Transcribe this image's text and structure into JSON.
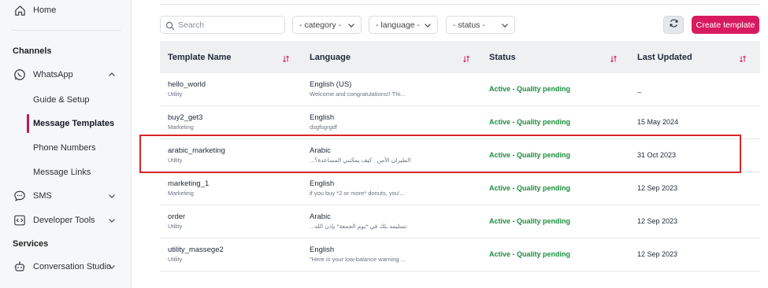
{
  "sidebar": {
    "home": "Home",
    "channels_title": "Channels",
    "whatsapp": "WhatsApp",
    "guide_setup": "Guide & Setup",
    "message_templates": "Message Templates",
    "phone_numbers": "Phone Numbers",
    "message_links": "Message Links",
    "sms": "SMS",
    "developer_tools": "Developer Tools",
    "services_title": "Services",
    "conversation_studio": "Conversation Studio"
  },
  "toolbar": {
    "search_placeholder": "Search",
    "category_label": "- category -",
    "language_label": "- language -",
    "status_label": "- status -",
    "create_label": "Create template"
  },
  "table": {
    "columns": [
      "Template Name",
      "Language",
      "Status",
      "Last Updated"
    ],
    "rows": [
      {
        "name": "hello_world",
        "category": "Utility",
        "language": "English (US)",
        "preview": "Welcome and congratulations!! Thi...",
        "status": "Active - Quality pending",
        "updated": "_"
      },
      {
        "name": "buy2_get3",
        "category": "Marketing",
        "language": "English",
        "preview": "dsgfsgrgdf",
        "status": "Active - Quality pending",
        "updated": "15 May 2024"
      },
      {
        "name": "arabic_marketing",
        "category": "Utility",
        "language": "Arabic",
        "preview": "...ة الطيران الأمن . كيف يمكنني المساعدة؟",
        "status": "Active - Quality pending",
        "updated": "31 Oct 2023"
      },
      {
        "name": "marketing_1",
        "category": "Marketing",
        "language": "English",
        "preview": "if you buy *2 or more* donuts, you'...",
        "status": "Active - Quality pending",
        "updated": "12 Sep 2023"
      },
      {
        "name": "order",
        "category": "Utility",
        "language": "Arabic",
        "preview": "...تسليمه ـلك في *يوم الجمعة* بإذن الله",
        "status": "Active - Quality pending",
        "updated": "12 Sep 2023"
      },
      {
        "name": "utility_massege2",
        "category": "Utility",
        "language": "English",
        "preview": "\"Here is your low-balance warning ...",
        "status": "Active - Quality pending",
        "updated": "12 Sep 2023"
      }
    ]
  },
  "colors": {
    "accent": "#d81b60",
    "status_active": "#1e8e3e",
    "highlight": "#d62828"
  },
  "icons": [
    "home-icon",
    "whatsapp-icon",
    "chevron-up-icon",
    "sms-icon",
    "chevron-down-icon",
    "code-icon",
    "bot-icon",
    "search-icon",
    "refresh-icon",
    "sort-icon"
  ]
}
